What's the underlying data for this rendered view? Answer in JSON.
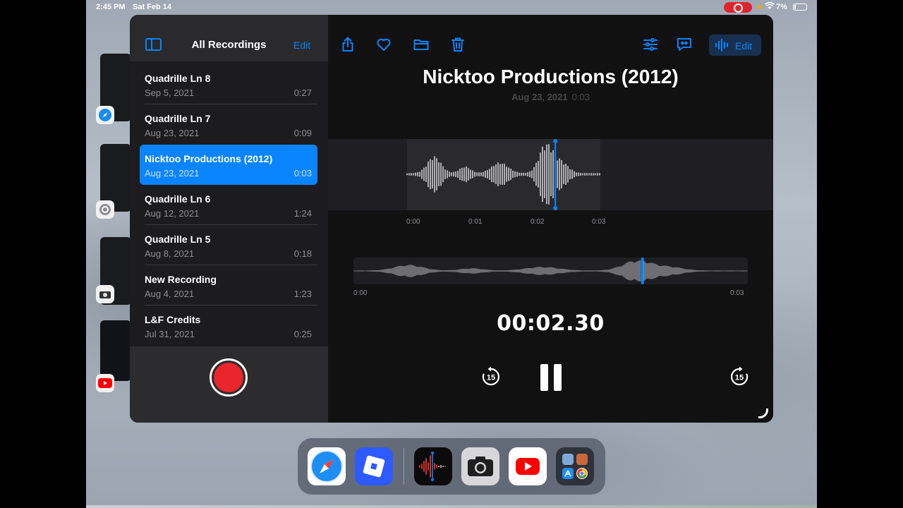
{
  "status_bar": {
    "time": "2:45 PM",
    "date": "Sat Feb 14",
    "battery": "7%"
  },
  "sidebar": {
    "title": "All Recordings",
    "edit_label": "Edit",
    "recordings": [
      {
        "name": "Quadrille Ln 8",
        "date": "Sep 5, 2021",
        "duration": "0:27",
        "selected": false
      },
      {
        "name": "Quadrille Ln 7",
        "date": "Aug 23, 2021",
        "duration": "0:09",
        "selected": false
      },
      {
        "name": "Nicktoo Productions (2012)",
        "date": "Aug 23, 2021",
        "duration": "0:03",
        "selected": true
      },
      {
        "name": "Quadrille Ln 6",
        "date": "Aug 12, 2021",
        "duration": "1:24",
        "selected": false
      },
      {
        "name": "Quadrille Ln 5",
        "date": "Aug 8, 2021",
        "duration": "0:18",
        "selected": false
      },
      {
        "name": "New Recording",
        "date": "Aug 4, 2021",
        "duration": "1:23",
        "selected": false
      },
      {
        "name": "L&F Credits",
        "date": "Jul 31, 2021",
        "duration": "0:25",
        "selected": false
      }
    ]
  },
  "toolbar": {
    "edit_label": "Edit",
    "icons": [
      "share-icon",
      "heart-icon",
      "folder-icon",
      "trash-icon",
      "sliders-icon",
      "transcript-icon",
      "waveform-icon"
    ]
  },
  "detail": {
    "title": "Nicktoo Productions (2012)",
    "date": "Aug 23, 2021",
    "duration": "0:03",
    "timeline_ticks": [
      "0:00",
      "0:01",
      "0:02",
      "0:03"
    ],
    "overview_start": "0:00",
    "overview_end": "0:03",
    "elapsed": "00:02.30",
    "skip_back_label": "15",
    "skip_forward_label": "15",
    "playhead_fraction": 0.767
  },
  "dock": {
    "apps": [
      "safari-icon",
      "roblox-icon",
      "voice-memos-icon",
      "camera-icon",
      "youtube-icon",
      "app-library-icon"
    ]
  },
  "colors": {
    "accent": "#0a84ff",
    "record": "#e8262b",
    "window_bg": "#1c1c1e"
  }
}
